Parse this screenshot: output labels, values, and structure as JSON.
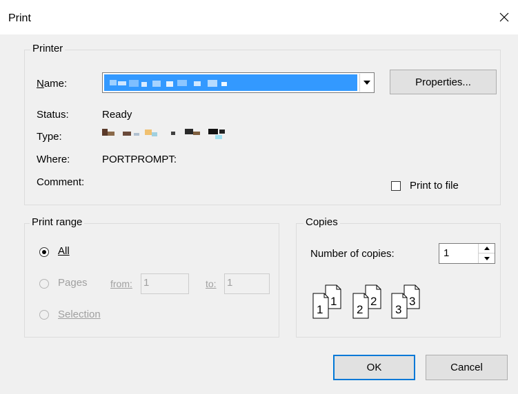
{
  "window": {
    "title": "Print"
  },
  "printer": {
    "group_label": "Printer",
    "name_label": "Name:",
    "properties_button": "Properties...",
    "status_label": "Status:",
    "status_value": "Ready",
    "type_label": "Type:",
    "where_label": "Where:",
    "where_value": "PORTPROMPT:",
    "comment_label": "Comment:",
    "print_to_file_label": "Print to file",
    "print_to_file_checked": false
  },
  "print_range": {
    "group_label": "Print range",
    "all_label": "All",
    "pages_label": "Pages",
    "from_label": "from:",
    "from_value": "1",
    "to_label": "to:",
    "to_value": "1",
    "selection_label": "Selection",
    "selected": "All"
  },
  "copies": {
    "group_label": "Copies",
    "number_label": "Number of copies:",
    "number_value": "1",
    "collate_pages": [
      "1",
      "2",
      "3"
    ]
  },
  "buttons": {
    "ok": "OK",
    "cancel": "Cancel"
  },
  "colors": {
    "accent": "#0078d7",
    "selection": "#3399ff",
    "dialog_bg": "#f0f0f0"
  }
}
